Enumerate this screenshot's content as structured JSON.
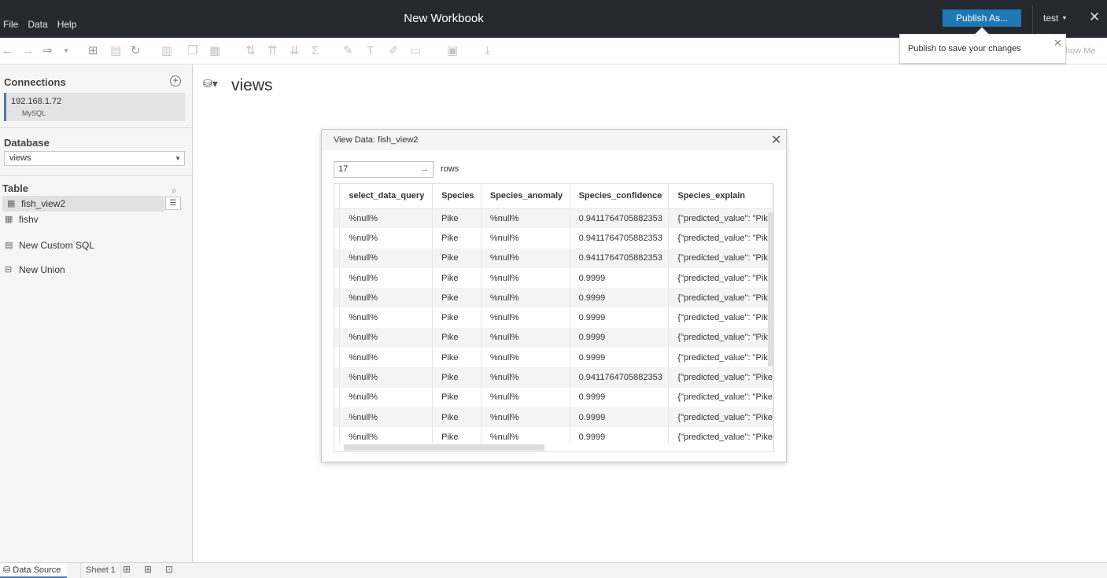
{
  "menu": [
    "File",
    "Data",
    "Help"
  ],
  "workbook_title": "New Workbook",
  "publish_label": "Publish As...",
  "user": "test",
  "tooltip": {
    "text": "Publish to save your changes"
  },
  "show_me_label": "how Me",
  "connections": {
    "heading": "Connections",
    "host": "192.168.1.72",
    "type": "MySQL"
  },
  "database": {
    "heading": "Database",
    "selected": "views"
  },
  "table_section": {
    "heading": "Table",
    "tables": [
      "fish_view2",
      "fishv"
    ],
    "new_custom_sql": "New Custom SQL",
    "new_union": "New Union"
  },
  "canvas": {
    "title": "views"
  },
  "dialog": {
    "title": "View Data: fish_view2",
    "rows_value": "17",
    "rows_label": "rows",
    "columns": [
      "select_data_query",
      "Species",
      "Species_anomaly",
      "Species_confidence",
      "Species_explain"
    ],
    "rows": [
      [
        "%null%",
        "Pike",
        "%null%",
        "0.9411764705882353",
        "{\"predicted_value\": \"Pike"
      ],
      [
        "%null%",
        "Pike",
        "%null%",
        "0.9411764705882353",
        "{\"predicted_value\": \"Pike"
      ],
      [
        "%null%",
        "Pike",
        "%null%",
        "0.9411764705882353",
        "{\"predicted_value\": \"Pike"
      ],
      [
        "%null%",
        "Pike",
        "%null%",
        "0.9999",
        "{\"predicted_value\": \"Pike"
      ],
      [
        "%null%",
        "Pike",
        "%null%",
        "0.9999",
        "{\"predicted_value\": \"Pike"
      ],
      [
        "%null%",
        "Pike",
        "%null%",
        "0.9999",
        "{\"predicted_value\": \"Pike"
      ],
      [
        "%null%",
        "Pike",
        "%null%",
        "0.9999",
        "{\"predicted_value\": \"Pike"
      ],
      [
        "%null%",
        "Pike",
        "%null%",
        "0.9999",
        "{\"predicted_value\": \"Pike"
      ],
      [
        "%null%",
        "Pike",
        "%null%",
        "0.9411764705882353",
        "{\"predicted_value\": \"Pike"
      ],
      [
        "%null%",
        "Pike",
        "%null%",
        "0.9999",
        "{\"predicted_value\": \"Pike"
      ],
      [
        "%null%",
        "Pike",
        "%null%",
        "0.9999",
        "{\"predicted_value\": \"Pike"
      ],
      [
        "%null%",
        "Pike",
        "%null%",
        "0.9999",
        "{\"predicted_value\": \"Pike"
      ]
    ]
  },
  "tabs": {
    "data_source": "Data Source",
    "sheet": "Sheet 1"
  },
  "colors": {
    "titlebar": "#25282f",
    "publish_button": "#1f77b4",
    "connection_accent": "#4e79a7"
  }
}
